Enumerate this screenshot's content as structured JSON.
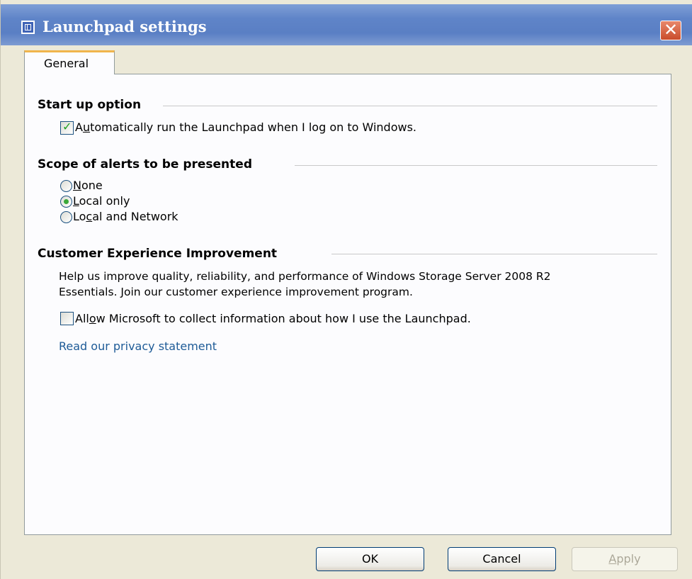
{
  "window": {
    "title": "Launchpad settings",
    "close_icon": "close-icon",
    "accent_color": "#5a7fc4"
  },
  "tabs": [
    {
      "label": "General",
      "selected": true
    }
  ],
  "startup": {
    "header": "Start up option",
    "auto_run": {
      "label_prefix": "A",
      "label_underlined": "u",
      "label_suffix": "tomatically run the Launchpad when I log on to Windows.",
      "checked": true
    }
  },
  "alerts": {
    "header": "Scope of alerts to be presented",
    "options": [
      {
        "prefix": "",
        "underlined": "N",
        "suffix": "one",
        "selected": false
      },
      {
        "prefix": "",
        "underlined": "L",
        "suffix": "ocal only",
        "selected": true
      },
      {
        "prefix": "Lo",
        "underlined": "c",
        "suffix": "al and Network",
        "selected": false
      }
    ]
  },
  "ceip": {
    "header": "Customer Experience Improvement",
    "description_line1": "Help us improve quality, reliability, and performance of Windows Storage Server 2008 R2",
    "description_line2": "Essentials. Join our customer experience improvement program.",
    "allow": {
      "label_prefix": "All",
      "label_underlined": "o",
      "label_suffix": "w Microsoft to collect information about how I use the Launchpad.",
      "checked": false
    },
    "privacy_link": "Read our privacy statement"
  },
  "buttons": {
    "ok": "OK",
    "cancel": "Cancel",
    "apply_prefix": "",
    "apply_underlined": "A",
    "apply_suffix": "pply"
  }
}
